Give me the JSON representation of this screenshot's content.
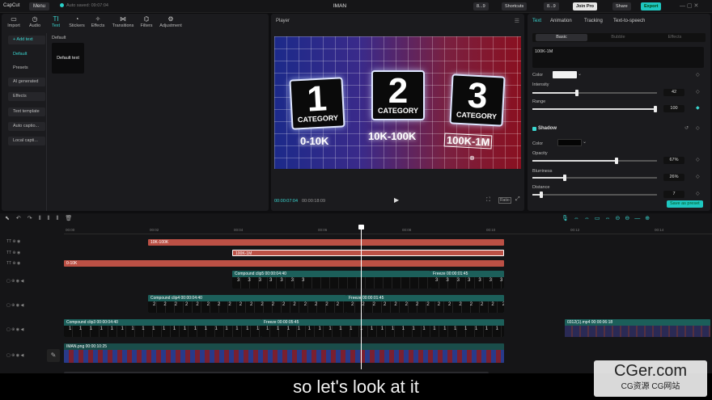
{
  "titlebar": {
    "logo": "CapCut",
    "menu": "Menu",
    "saved": "Auto saved: 09:07:04",
    "project": "IMAN",
    "storage": "8...9",
    "shortcuts": "Shortcuts",
    "join": "Join Pro",
    "share": "Share",
    "export": "Export"
  },
  "tools": [
    {
      "label": "Import",
      "icon": "▭"
    },
    {
      "label": "Audio",
      "icon": "◷"
    },
    {
      "label": "Text",
      "icon": "TI"
    },
    {
      "label": "Stickers",
      "icon": "◔"
    },
    {
      "label": "Effects",
      "icon": "✧"
    },
    {
      "label": "Transitions",
      "icon": "⋈"
    },
    {
      "label": "Filters",
      "icon": "⌬"
    },
    {
      "label": "Adjustment",
      "icon": "⚙"
    }
  ],
  "sidebar": [
    "+ Add text",
    "Default",
    "Presets",
    "AI generated",
    "Effects",
    "Text template",
    "Auto captio...",
    "Local capti..."
  ],
  "text_panel": {
    "section": "Default",
    "card": "Default text"
  },
  "player": {
    "title": "Player",
    "time_current": "00:00:07:04",
    "time_total": "00:00:18:09",
    "ratio": "Ratio",
    "cards": [
      {
        "num": "1",
        "cat": "CATEGORY",
        "range": "0-10K"
      },
      {
        "num": "2",
        "cat": "CATEGORY",
        "range": "10K-100K"
      },
      {
        "num": "3",
        "cat": "CATEGORY",
        "range": "100K-1M"
      }
    ]
  },
  "inspector": {
    "tabs": [
      "Text",
      "Animation",
      "Tracking",
      "Text-to-speech"
    ],
    "subtabs": [
      "Basic",
      "Bubble",
      "Effects"
    ],
    "text_value": "100K-1M",
    "color_label": "Color",
    "intensity_label": "Intensity",
    "intensity_value": "42",
    "range_label": "Range",
    "range_value": "100",
    "shadow_label": "Shadow",
    "shadow_color_label": "Color",
    "opacity_label": "Opacity",
    "opacity_value": "67%",
    "blur_label": "Blurriness",
    "blur_value": "26%",
    "distance_label": "Distance",
    "distance_value": "7",
    "save_preset": "Save as preset"
  },
  "timeline": {
    "ruler": [
      "00:00",
      "00:02",
      "00:04",
      "00:06",
      "00:08",
      "00:10",
      "00:12",
      "00:14"
    ],
    "text_tracks": [
      {
        "label": "10K-100K"
      },
      {
        "label": "100K-1M"
      },
      {
        "label": "0-10K"
      }
    ],
    "clip_a": "Compound clip5  00:00:04:40",
    "freeze_a": "Freeze  00:00:01:45",
    "clip_b": "Compound clip4  00:00:04:40",
    "freeze_b": "Freeze  00:00:01:45",
    "clip_c": "Compound clip3  00:00:04:40",
    "freeze_c": "Freeze  00:00:05:45",
    "clip_d": "0312(1).mp4  00:00:06:18",
    "main_clip": "IMAN.png  00:00:10:25",
    "strip_a": "3333333",
    "strip_b": "2222222222222222222",
    "strip_c": "11111111111111111111111"
  },
  "subtitle": "so let's look at it",
  "watermark": {
    "line1": "CGer.com",
    "line2": "CG资源 CG网站"
  }
}
